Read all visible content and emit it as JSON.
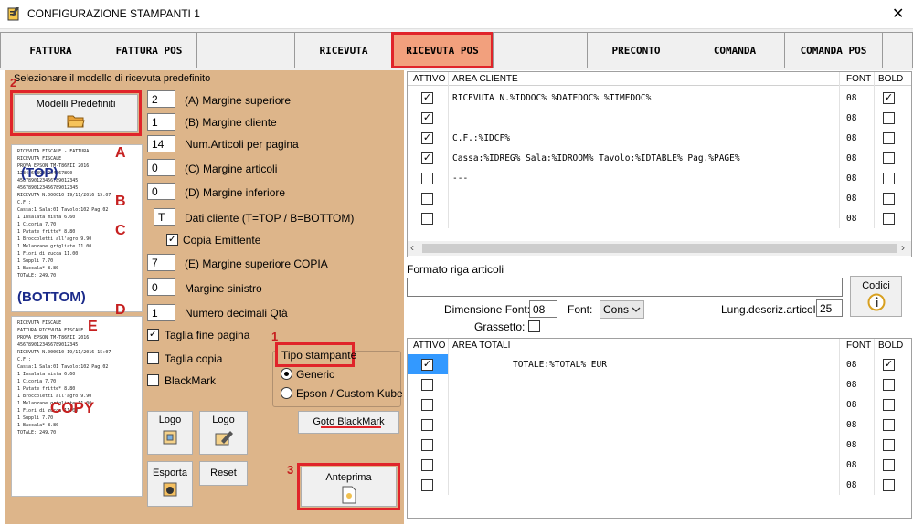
{
  "window": {
    "title": "CONFIGURAZIONE STAMPANTI 1",
    "close_glyph": "✕"
  },
  "tabs": [
    "FATTURA",
    "FATTURA POS",
    "",
    "RICEVUTA",
    "RICEVUTA POS",
    "",
    "PRECONTO",
    "COMANDA",
    "COMANDA POS",
    ""
  ],
  "active_tab": "RICEVUTA POS",
  "left": {
    "section_title": "Selezionare il modello di ricevuta predefinito",
    "modelli_button": "Modelli Predefiniti",
    "markers": {
      "n1": "1",
      "n2": "2",
      "n3": "3",
      "A": "A",
      "B": "B",
      "C": "C",
      "D": "D",
      "E": "E",
      "TOP": "(TOP)",
      "BOTTOM": "(BOTTOM)",
      "COPY": "COPY"
    },
    "fields": [
      {
        "value": "2",
        "label": "(A) Margine superiore"
      },
      {
        "value": "1",
        "label": "(B) Margine cliente"
      },
      {
        "value": "14",
        "label": "Num.Articoli per pagina"
      },
      {
        "value": "0",
        "label": "(C) Margine articoli"
      },
      {
        "value": "0",
        "label": "(D) Margine inferiore"
      },
      {
        "value": "T",
        "label": "Dati cliente (T=TOP / B=BOTTOM)"
      }
    ],
    "copia_emittente": "Copia Emittente",
    "fields2": [
      {
        "value": "7",
        "label": "(E) Margine superiore COPIA"
      },
      {
        "value": "0",
        "label": "Margine sinistro"
      },
      {
        "value": "1",
        "label": "Numero decimali Qtà"
      }
    ],
    "checks": [
      {
        "label": "Taglia fine pagina",
        "checked": true
      },
      {
        "label": "Taglia copia",
        "checked": false
      },
      {
        "label": "BlackMark",
        "checked": false
      }
    ],
    "tipo_stampante": {
      "title": "Tipo stampante",
      "options": [
        "Generic",
        "Epson / Custom Kube"
      ],
      "selected": "Generic"
    },
    "goto_blackmark": "Goto BlackMark",
    "logo1": "Logo",
    "logo2": "Logo",
    "esporta": "Esporta",
    "reset": "Reset",
    "anteprima": "Anteprima",
    "receipt_top": [
      "RICEVUTA FISCALE - FATTURA",
      "RICEVUTA FISCALE",
      "PROVA EPSON TM-T86FII 2016",
      "12345678901234567890",
      "4567890123456789012345",
      "4567890123456789012345",
      "RICEVUTA N.000010  19/11/2016 15:07",
      "C.F.:",
      "Cassa:1 Sala:01 Tavolo:102 Pag.02",
      "1 Insalata mista     6.60",
      "1 Cicoria           7.70",
      "1 Patate fritte*    8.80",
      "1 Broccoletti all'agro 9.90",
      "1 Melanzane grigliate 11.00",
      "1 Fiori di zucca    11.00",
      "1 Suppli            7.70",
      "1 Baccala*          8.80",
      "TOTALE:          249.70"
    ],
    "receipt_bottom": [
      "RICEVUTA FISCALE",
      "FATTURA   RICEVUTA FISCALE",
      "PROVA EPSON TM-T86FII 2016",
      "4567890123456789012345",
      "RICEVUTA N.000010  19/11/2016 15:07",
      "C.F.:",
      "Cassa:1 Sala:01 Tavolo:102 Pag.02",
      "1 Insalata mista     6.60",
      "1 Cicoria           7.70",
      "1 Patate fritte*    8.80",
      "1 Broccoletti all'agro 9.90",
      "1 Melanzane grigliate 11.00",
      "1 Fiori di zucca    11.00",
      "1 Suppli            7.70",
      "1 Baccala*          8.80",
      "TOTALE:          249.70"
    ]
  },
  "cliente_grid": {
    "headers": [
      "ATTIVO",
      "AREA CLIENTE",
      "FONT",
      "BOLD"
    ],
    "rows": [
      {
        "attivo": true,
        "text": "RICEVUTA N.%IDDOC% %DATEDOC% %TIMEDOC%",
        "font": "08",
        "bold": true
      },
      {
        "attivo": true,
        "text": "",
        "font": "08",
        "bold": false
      },
      {
        "attivo": true,
        "text": "C.F.:%IDCF%",
        "font": "08",
        "bold": false
      },
      {
        "attivo": true,
        "text": "Cassa:%IDREG% Sala:%IDROOM% Tavolo:%IDTABLE% Pag.%PAGE%",
        "font": "08",
        "bold": false
      },
      {
        "attivo": false,
        "text": "---",
        "font": "08",
        "bold": false
      },
      {
        "attivo": false,
        "text": "",
        "font": "08",
        "bold": false
      },
      {
        "attivo": false,
        "text": "",
        "font": "08",
        "bold": false
      }
    ]
  },
  "articoli": {
    "title": "Formato riga articoli",
    "value": "",
    "codici": "Codici",
    "dimensione_font_label": "Dimensione Font:",
    "dimensione_font": "08",
    "font_label": "Font:",
    "font_value": "Cons",
    "lung_label": "Lung.descriz.articoli:",
    "lung_value": "25",
    "grassetto": "Grassetto:"
  },
  "totali_grid": {
    "headers": [
      "ATTIVO",
      "AREA TOTALI",
      "FONT",
      "BOLD"
    ],
    "rows": [
      {
        "attivo": true,
        "text": "TOTALE:%TOTAL% EUR",
        "font": "08",
        "bold": true
      },
      {
        "attivo": false,
        "text": "",
        "font": "08",
        "bold": false
      },
      {
        "attivo": false,
        "text": "",
        "font": "08",
        "bold": false
      },
      {
        "attivo": false,
        "text": "",
        "font": "08",
        "bold": false
      },
      {
        "attivo": false,
        "text": "",
        "font": "08",
        "bold": false
      },
      {
        "attivo": false,
        "text": "",
        "font": "08",
        "bold": false
      },
      {
        "attivo": false,
        "text": "",
        "font": "08",
        "bold": false
      }
    ]
  }
}
